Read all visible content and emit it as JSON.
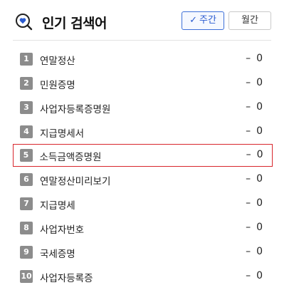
{
  "header": {
    "title": "인기 검색어",
    "weekly_label": "주간",
    "monthly_label": "월간"
  },
  "colors": {
    "accent": "#2a5bd0",
    "highlight_border": "#d8262c",
    "rank_badge": "#8c8c8c"
  },
  "items": [
    {
      "rank": "1",
      "term": "연말정산",
      "change_symbol": "–",
      "change_value": "0"
    },
    {
      "rank": "2",
      "term": "민원증명",
      "change_symbol": "–",
      "change_value": "0"
    },
    {
      "rank": "3",
      "term": "사업자등록증명원",
      "change_symbol": "–",
      "change_value": "0"
    },
    {
      "rank": "4",
      "term": "지급명세서",
      "change_symbol": "–",
      "change_value": "0"
    },
    {
      "rank": "5",
      "term": "소득금액증명원",
      "change_symbol": "–",
      "change_value": "0"
    },
    {
      "rank": "6",
      "term": "연말정산미리보기",
      "change_symbol": "–",
      "change_value": "0"
    },
    {
      "rank": "7",
      "term": "지급명세",
      "change_symbol": "–",
      "change_value": "0"
    },
    {
      "rank": "8",
      "term": "사업자번호",
      "change_symbol": "–",
      "change_value": "0"
    },
    {
      "rank": "9",
      "term": "국세증명",
      "change_symbol": "–",
      "change_value": "0"
    },
    {
      "rank": "10",
      "term": "사업자등록증",
      "change_symbol": "–",
      "change_value": "0"
    }
  ]
}
